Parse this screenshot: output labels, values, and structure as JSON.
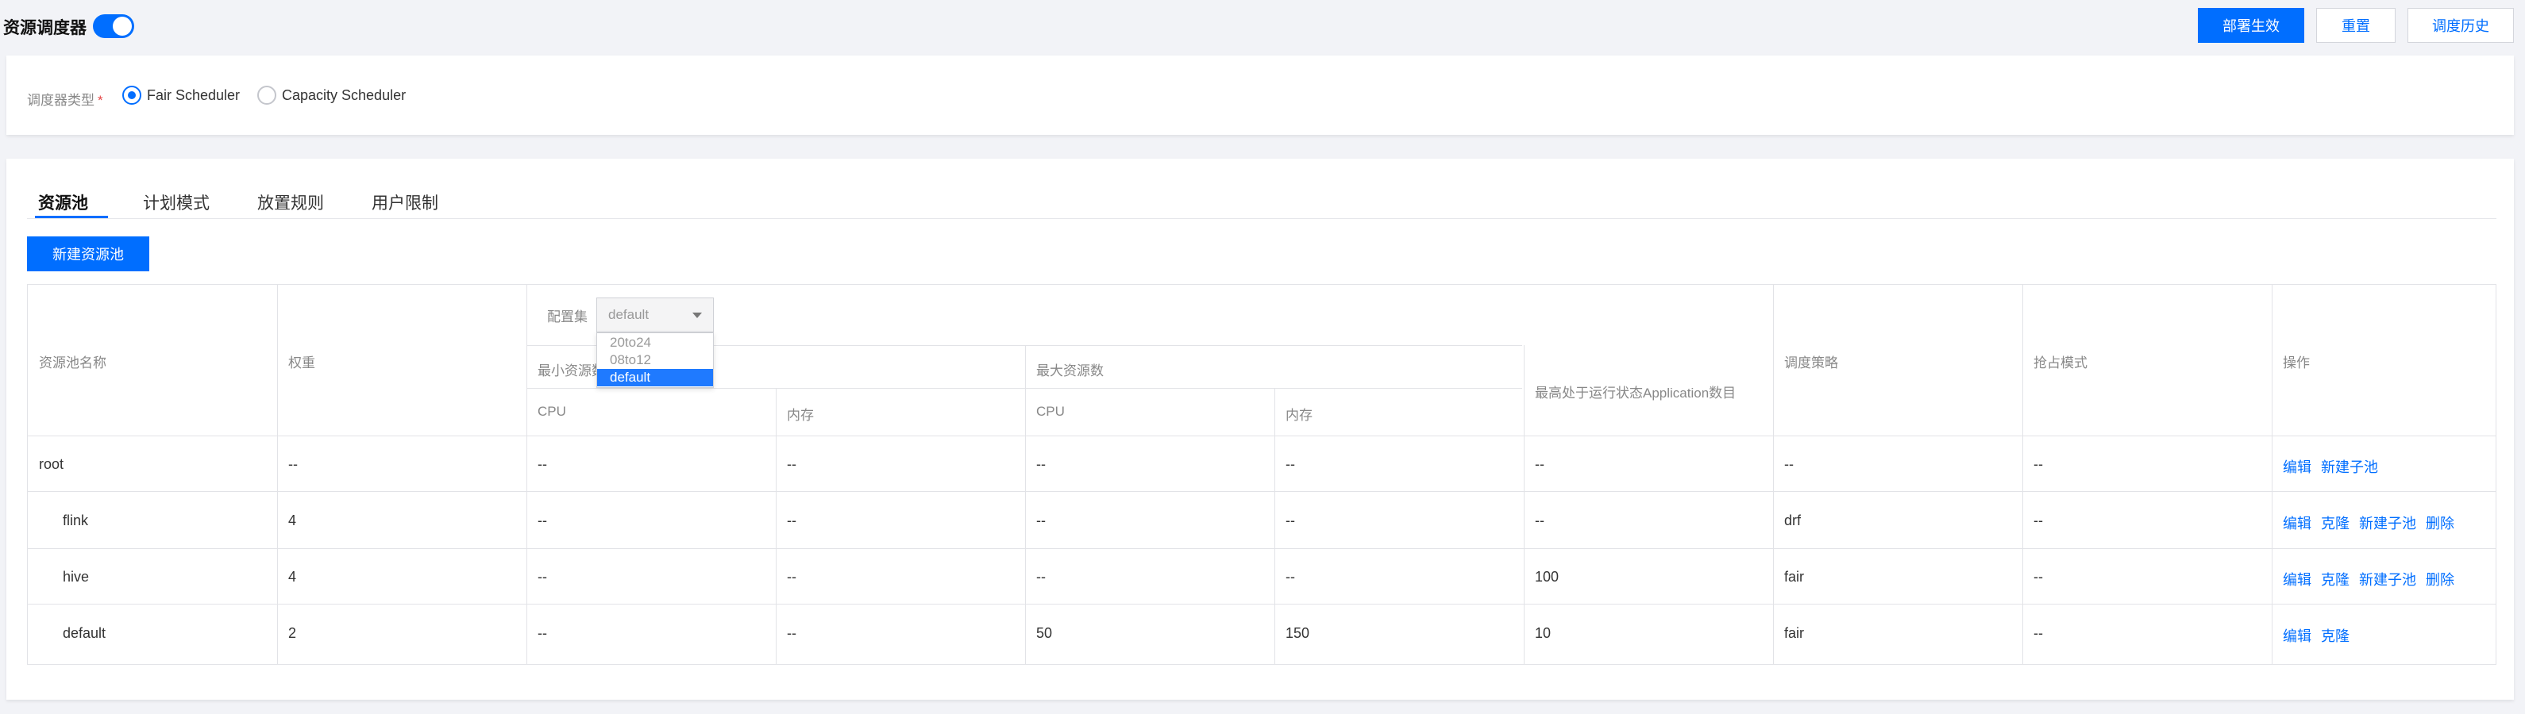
{
  "header": {
    "title": "资源调度器",
    "toggle_on": true,
    "buttons": {
      "deploy": "部署生效",
      "reset": "重置",
      "history": "调度历史"
    }
  },
  "scheduler": {
    "label": "调度器类型",
    "required_mark": "*",
    "options": [
      {
        "label": "Fair Scheduler",
        "checked": true
      },
      {
        "label": "Capacity Scheduler",
        "checked": false
      }
    ]
  },
  "tabs": [
    "资源池",
    "计划模式",
    "放置规则",
    "用户限制"
  ],
  "active_tab": "资源池",
  "new_pool_button": "新建资源池",
  "config": {
    "label": "配置集",
    "selected": "default",
    "options": [
      "20to24",
      "08to12",
      "default"
    ]
  },
  "table": {
    "headers": {
      "name": "资源池名称",
      "weight": "权重",
      "min_resources": "最小资源数",
      "max_resources": "最大资源数",
      "max_apps": "最高处于运行状态Application数目",
      "policy": "调度策略",
      "preempt": "抢占模式",
      "actions": "操作",
      "cpu": "CPU",
      "memory": "内存"
    },
    "rows": [
      {
        "name": "root",
        "weight": "--",
        "min_cpu": "--",
        "min_mem": "--",
        "max_cpu": "--",
        "max_mem": "--",
        "max_apps": "--",
        "policy": "--",
        "preempt": "--",
        "actions": [
          "编辑",
          "新建子池"
        ]
      },
      {
        "name": "flink",
        "weight": "4",
        "min_cpu": "--",
        "min_mem": "--",
        "max_cpu": "--",
        "max_mem": "--",
        "max_apps": "--",
        "policy": "drf",
        "preempt": "--",
        "actions": [
          "编辑",
          "克隆",
          "新建子池",
          "删除"
        ]
      },
      {
        "name": "hive",
        "weight": "4",
        "min_cpu": "--",
        "min_mem": "--",
        "max_cpu": "--",
        "max_mem": "--",
        "max_apps": "100",
        "policy": "fair",
        "preempt": "--",
        "actions": [
          "编辑",
          "克隆",
          "新建子池",
          "删除"
        ]
      },
      {
        "name": "default",
        "weight": "2",
        "min_cpu": "--",
        "min_mem": "--",
        "max_cpu": "50",
        "max_mem": "150",
        "max_apps": "10",
        "policy": "fair",
        "preempt": "--",
        "actions": [
          "编辑",
          "克隆"
        ]
      }
    ]
  },
  "colors": {
    "accent": "#006eff",
    "required": "#e54545"
  }
}
